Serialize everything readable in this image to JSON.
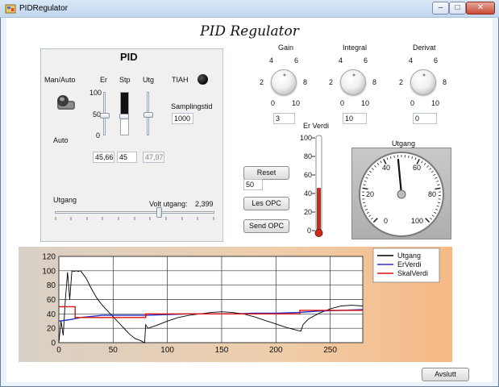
{
  "window": {
    "title": "PIDRegulator"
  },
  "form_title": "PID Regulator",
  "pid_group": {
    "title": "PID",
    "man_auto_label": "Man/Auto",
    "auto_label": "Auto",
    "er_label": "Er",
    "stp_label": "Stp",
    "utg_label": "Utg",
    "tiah_label": "TIAH",
    "samplingstid_label": "Samplingstid",
    "samplingstid_value": "1000",
    "scale": [
      "100",
      "50",
      "0"
    ],
    "er_value": "45,66",
    "stp_value": "45",
    "utg_value": "47,97",
    "utgang_label": "Utgang",
    "volt_label": "Volt utgang:",
    "volt_value": "2,399",
    "utgang_level": 0.65,
    "er_level": 0.46,
    "stp_level": 0.45,
    "utg_level": 0.48
  },
  "knobs": [
    {
      "label": "Gain",
      "value": "3"
    },
    {
      "label": "Integral",
      "value": "10"
    },
    {
      "label": "Derivat",
      "value": "0"
    }
  ],
  "knob_scale": [
    "0",
    "2",
    "4",
    "6",
    "8",
    "10"
  ],
  "er_verdi": {
    "label": "Er Verdi",
    "scale": [
      "100",
      "80",
      "60",
      "40",
      "20",
      "0"
    ],
    "level": 0.46
  },
  "buttons": {
    "reset": "Reset",
    "reset_value": "50",
    "les_opc": "Les OPC",
    "send_opc": "Send OPC",
    "avslutt": "Avslutt"
  },
  "gauge": {
    "title": "Utgang",
    "labels": [
      "0",
      "20",
      "40",
      "60",
      "80",
      "100"
    ],
    "value": 48
  },
  "colors": {
    "utgang": "#000000",
    "erverdi": "#2233cc",
    "skalverdi": "#dd1111"
  },
  "chart_data": {
    "type": "line",
    "xlim": [
      0,
      280
    ],
    "ylim": [
      0,
      120
    ],
    "x_ticks": [
      "0",
      "50",
      "100",
      "150",
      "200",
      "250"
    ],
    "y_ticks": [
      "0",
      "20",
      "40",
      "60",
      "80",
      "100",
      "120"
    ],
    "grid": true,
    "legend": "top-right",
    "series": [
      {
        "name": "Utgang",
        "color": "#000000",
        "x": [
          0,
          2,
          4,
          6,
          8,
          10,
          12,
          14,
          16,
          18,
          20,
          25,
          30,
          35,
          40,
          45,
          50,
          55,
          60,
          65,
          70,
          75,
          79,
          80,
          82,
          90,
          100,
          110,
          120,
          130,
          140,
          150,
          160,
          170,
          180,
          190,
          200,
          210,
          220,
          223,
          225,
          230,
          240,
          250,
          260,
          270,
          280
        ],
        "y": [
          0,
          30,
          10,
          60,
          98,
          60,
          100,
          99,
          100,
          99,
          100,
          90,
          75,
          62,
          52,
          44,
          36,
          28,
          20,
          12,
          6,
          3,
          0,
          25,
          20,
          24,
          30,
          35,
          38,
          40,
          42,
          43,
          42,
          40,
          36,
          31,
          26,
          21,
          17,
          16,
          25,
          33,
          41,
          47,
          51,
          52,
          51
        ]
      },
      {
        "name": "ErVerdi",
        "color": "#2233cc",
        "x": [
          0,
          10,
          20,
          40,
          60,
          80,
          100,
          120,
          140,
          160,
          180,
          200,
          220,
          240,
          260,
          280
        ],
        "y": [
          30,
          32,
          35,
          38,
          38,
          38,
          39,
          40,
          40,
          40,
          41,
          41,
          42,
          44,
          45,
          46
        ]
      },
      {
        "name": "SkalVerdi",
        "color": "#dd1111",
        "x": [
          0,
          15,
          15,
          80,
          80,
          222,
          222,
          280
        ],
        "y": [
          50,
          50,
          35,
          35,
          40,
          40,
          45,
          45
        ]
      }
    ]
  }
}
